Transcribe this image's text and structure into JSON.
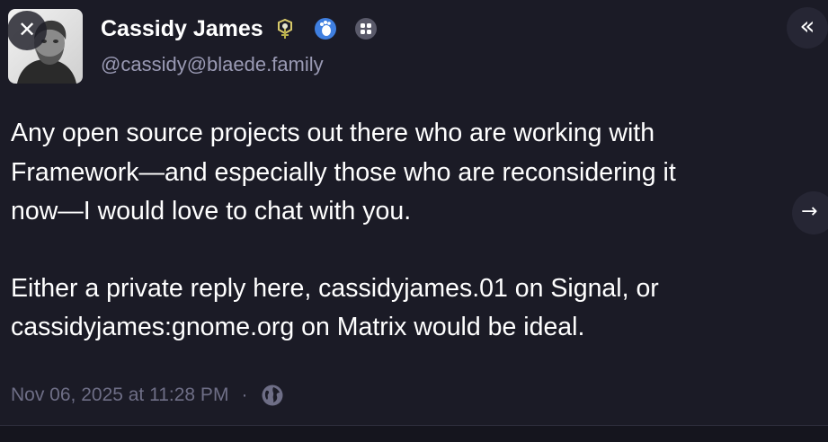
{
  "post": {
    "author": {
      "display_name": "Cassidy James",
      "handle": "@cassidy@blaede.family"
    },
    "badges": [
      "hexagon-emoji-icon",
      "gnome-foot-icon",
      "app-grid-icon"
    ],
    "paragraphs": [
      "Any open source projects out there who are working with\nFramework—and especially those who are reconsidering it\nnow—I would love to chat with you.",
      "Either a private reply here, cassidyjames.01 on Signal, or\ncassidyjames:gnome.org on Matrix would be ideal."
    ],
    "timestamp": "Nov 06, 2025 at 11:28 PM",
    "separator": "·",
    "visibility_icon": "globe-icon"
  },
  "controls": {
    "close_glyph": "✕",
    "collapse_glyph": "«",
    "next_glyph": "→"
  },
  "colors": {
    "background": "#1b1b26",
    "text_primary": "#ffffff",
    "text_secondary": "#9a9ab4",
    "text_meta": "#6e6e86",
    "badge_blue": "#3f7fe0"
  }
}
